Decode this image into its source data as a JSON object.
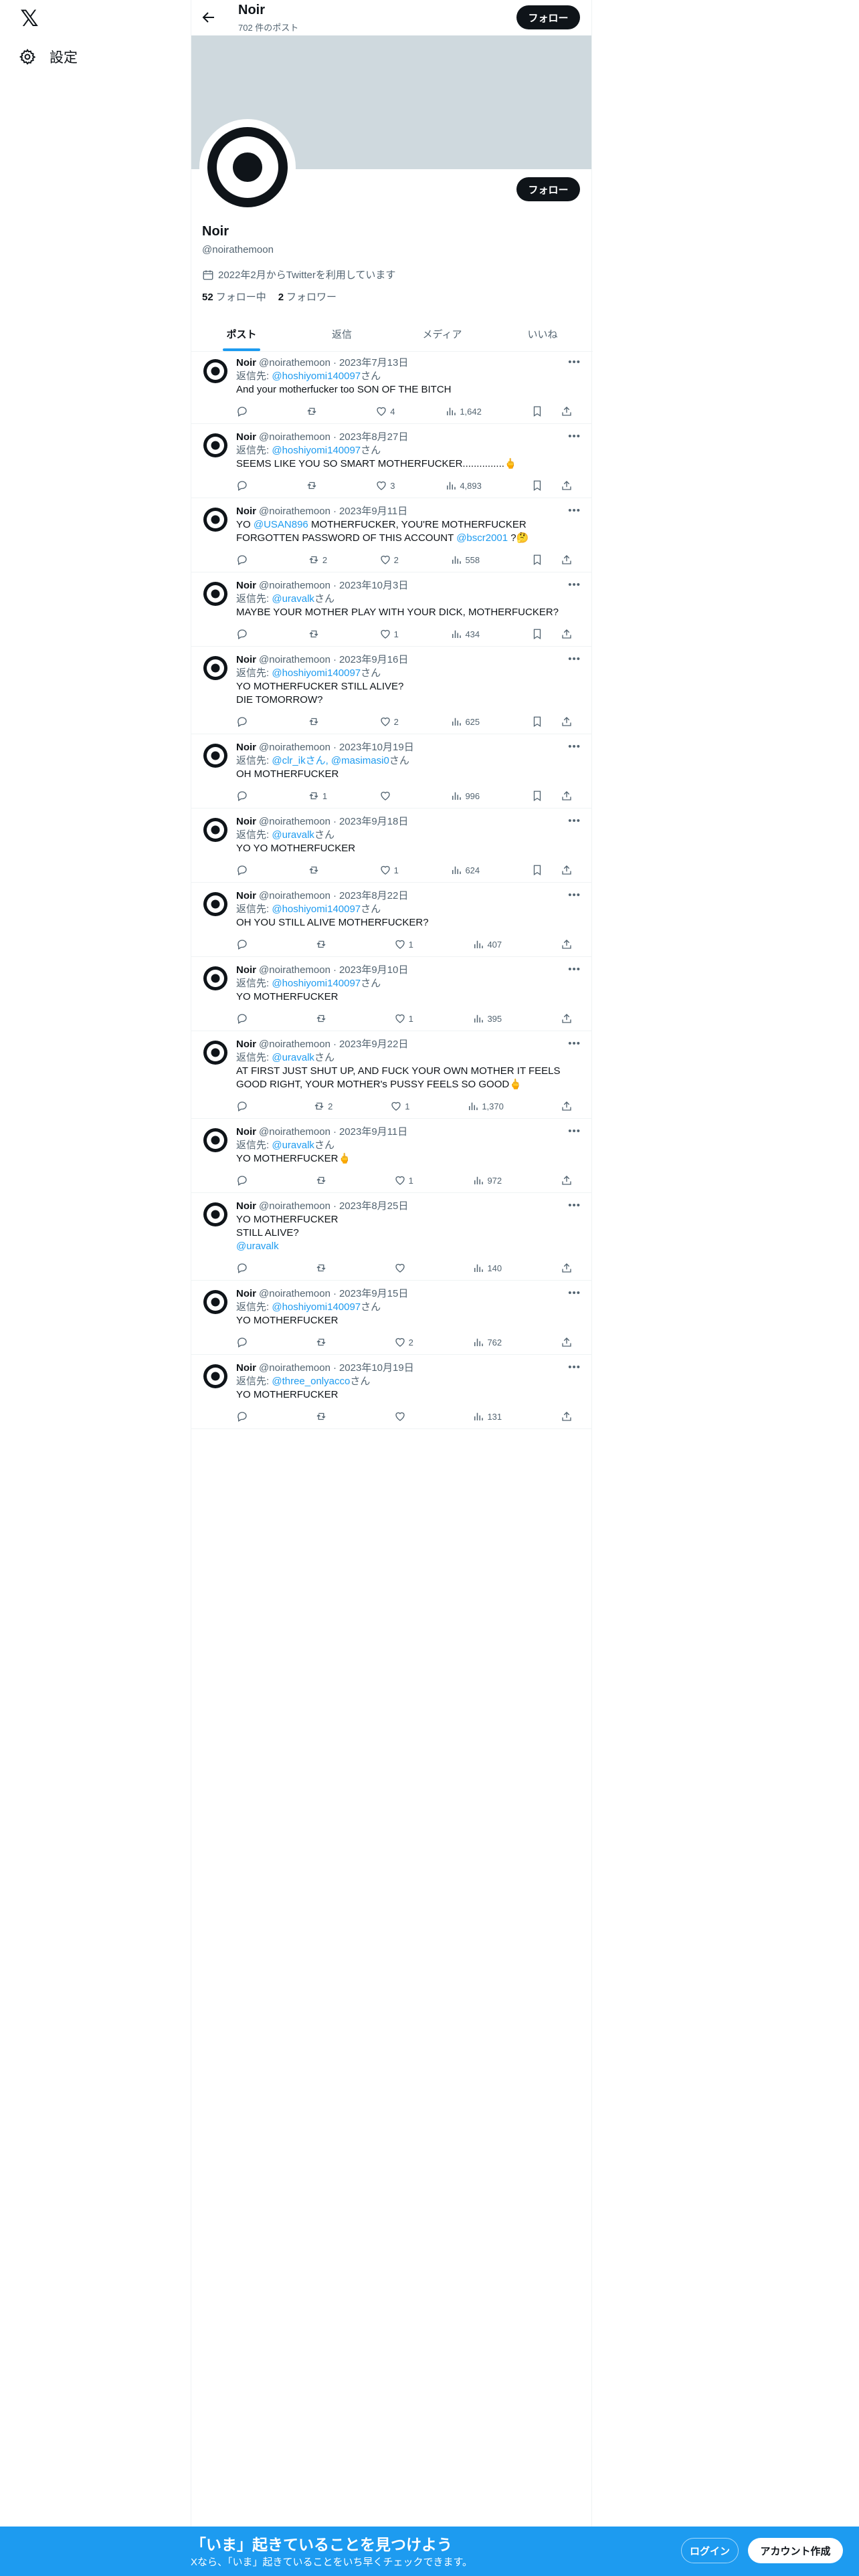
{
  "nav": {
    "logo": "𝕏",
    "settings_label": "設定"
  },
  "header": {
    "name": "Noir",
    "post_count": "702 件のポスト",
    "follow_label": "フォロー"
  },
  "profile": {
    "name": "Noir",
    "handle": "@noirathemoon",
    "joined": "2022年2月からTwitterを利用しています",
    "following_count": "52",
    "following_label": "フォロー中",
    "followers_count": "2",
    "followers_label": "フォロワー",
    "follow_label": "フォロー"
  },
  "tabs": [
    {
      "label": "ポスト",
      "active": true
    },
    {
      "label": "返信",
      "active": false
    },
    {
      "label": "メディア",
      "active": false
    },
    {
      "label": "いいね",
      "active": false
    }
  ],
  "tweets": [
    {
      "name": "Noir",
      "handle": "@noirathemoon",
      "date": "2023年7月13日",
      "reply_prefix": "返信先: ",
      "reply_to": "@hoshiyomi140097",
      "reply_suffix": "さん",
      "text": "And your motherfucker too SON OF THE BITCH",
      "replies": "",
      "retweets": "",
      "likes": "4",
      "views": "1,642",
      "bookmark": true
    },
    {
      "name": "Noir",
      "handle": "@noirathemoon",
      "date": "2023年8月27日",
      "reply_prefix": "返信先: ",
      "reply_to": "@hoshiyomi140097",
      "reply_suffix": "さん",
      "text": "SEEMS LIKE YOU SO SMART MOTHERFUCKER...............🖕",
      "replies": "",
      "retweets": "",
      "likes": "3",
      "views": "4,893",
      "bookmark": true
    },
    {
      "name": "Noir",
      "handle": "@noirathemoon",
      "date": "2023年9月11日",
      "reply_prefix": "",
      "reply_to": "",
      "reply_suffix": "",
      "text_parts": [
        "YO ",
        "@USAN896",
        " MOTHERFUCKER, YOU'RE MOTHERFUCKER FORGOTTEN PASSWORD OF THIS ACCOUNT ",
        "@bscr2001",
        " ?🤔"
      ],
      "replies": "",
      "retweets": "2",
      "likes": "2",
      "views": "558",
      "bookmark": true
    },
    {
      "name": "Noir",
      "handle": "@noirathemoon",
      "date": "2023年10月3日",
      "reply_prefix": "返信先: ",
      "reply_to": "@uravalk",
      "reply_suffix": "さん",
      "text": "MAYBE YOUR MOTHER PLAY WITH YOUR DICK, MOTHERFUCKER?",
      "replies": "",
      "retweets": "",
      "likes": "1",
      "views": "434",
      "bookmark": true
    },
    {
      "name": "Noir",
      "handle": "@noirathemoon",
      "date": "2023年9月16日",
      "reply_prefix": "返信先: ",
      "reply_to": "@hoshiyomi140097",
      "reply_suffix": "さん",
      "text": "YO MOTHERFUCKER STILL ALIVE?\nDIE TOMORROW?",
      "replies": "",
      "retweets": "",
      "likes": "2",
      "views": "625",
      "bookmark": true
    },
    {
      "name": "Noir",
      "handle": "@noirathemoon",
      "date": "2023年10月19日",
      "reply_prefix": "返信先: ",
      "reply_to": "@clr_ikさん, @masimasi0",
      "reply_suffix": "さん",
      "text": "OH MOTHERFUCKER",
      "replies": "",
      "retweets": "1",
      "likes": "",
      "views": "996",
      "bookmark": true
    },
    {
      "name": "Noir",
      "handle": "@noirathemoon",
      "date": "2023年9月18日",
      "reply_prefix": "返信先: ",
      "reply_to": "@uravalk",
      "reply_suffix": "さん",
      "text": "YO YO MOTHERFUCKER",
      "replies": "",
      "retweets": "",
      "likes": "1",
      "views": "624",
      "bookmark": true
    },
    {
      "name": "Noir",
      "handle": "@noirathemoon",
      "date": "2023年8月22日",
      "reply_prefix": "返信先: ",
      "reply_to": "@hoshiyomi140097",
      "reply_suffix": "さん",
      "text": "OH YOU STILL ALIVE MOTHERFUCKER?",
      "replies": "",
      "retweets": "",
      "likes": "1",
      "views": "407",
      "bookmark": false
    },
    {
      "name": "Noir",
      "handle": "@noirathemoon",
      "date": "2023年9月10日",
      "reply_prefix": "返信先: ",
      "reply_to": "@hoshiyomi140097",
      "reply_suffix": "さん",
      "text": "YO MOTHERFUCKER",
      "replies": "",
      "retweets": "",
      "likes": "1",
      "views": "395",
      "bookmark": false
    },
    {
      "name": "Noir",
      "handle": "@noirathemoon",
      "date": "2023年9月22日",
      "reply_prefix": "返信先: ",
      "reply_to": "@uravalk",
      "reply_suffix": "さん",
      "text": "AT FIRST JUST SHUT UP, AND FUCK YOUR OWN MOTHER IT FEELS GOOD RIGHT, YOUR MOTHER's PUSSY FEELS SO GOOD🖕",
      "replies": "",
      "retweets": "2",
      "likes": "1",
      "views": "1,370",
      "bookmark": false
    },
    {
      "name": "Noir",
      "handle": "@noirathemoon",
      "date": "2023年9月11日",
      "reply_prefix": "返信先: ",
      "reply_to": "@uravalk",
      "reply_suffix": "さん",
      "text": "YO MOTHERFUCKER🖕",
      "replies": "",
      "retweets": "",
      "likes": "1",
      "views": "972",
      "bookmark": false
    },
    {
      "name": "Noir",
      "handle": "@noirathemoon",
      "date": "2023年8月25日",
      "reply_prefix": "",
      "reply_to": "",
      "reply_suffix": "",
      "text_parts": [
        "YO MOTHERFUCKER\nSTILL ALIVE?\n",
        "@uravalk",
        ""
      ],
      "replies": "",
      "retweets": "",
      "likes": "",
      "views": "140",
      "bookmark": false
    },
    {
      "name": "Noir",
      "handle": "@noirathemoon",
      "date": "2023年9月15日",
      "reply_prefix": "返信先: ",
      "reply_to": "@hoshiyomi140097",
      "reply_suffix": "さん",
      "text": "YO MOTHERFUCKER",
      "replies": "",
      "retweets": "",
      "likes": "2",
      "views": "762",
      "bookmark": false
    },
    {
      "name": "Noir",
      "handle": "@noirathemoon",
      "date": "2023年10月19日",
      "reply_prefix": "返信先: ",
      "reply_to": "@three_onlyacco",
      "reply_suffix": "さん",
      "text": "YO MOTHERFUCKER",
      "replies": "",
      "retweets": "",
      "likes": "",
      "views": "131",
      "bookmark": false
    }
  ],
  "bottom_bar": {
    "title": "「いま」起きていることを見つけよう",
    "subtitle": "Xなら、「いま」起きていることをいち早くチェックできます。",
    "login_label": "ログイン",
    "signup_label": "アカウント作成"
  },
  "colors": {
    "accent": "#1d9bf0",
    "text": "#0f1419",
    "muted": "#536471",
    "banner": "#cfd9de",
    "bottom_bar": "#1d9bf0"
  }
}
